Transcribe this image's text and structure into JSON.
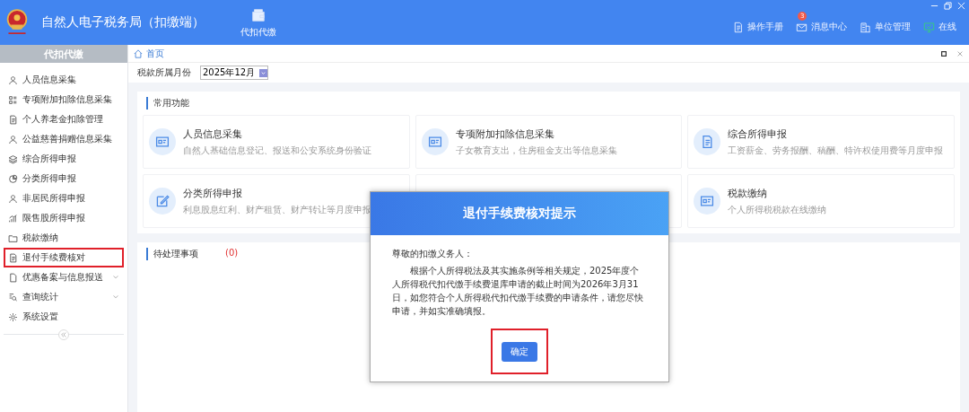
{
  "app": {
    "title": "自然人电子税务局（扣缴端）"
  },
  "top_nav": [
    {
      "label": "代扣代缴"
    }
  ],
  "toolbar": [
    {
      "label": "操作手册"
    },
    {
      "label": "消息中心",
      "badge": "3"
    },
    {
      "label": "单位管理"
    },
    {
      "label": "在线"
    }
  ],
  "sidebar": {
    "title": "代扣代缴",
    "items": [
      {
        "label": "人员信息采集",
        "expandable": false,
        "highlighted": false
      },
      {
        "label": "专项附加扣除信息采集",
        "expandable": false,
        "highlighted": false
      },
      {
        "label": "个人养老金扣除管理",
        "expandable": false,
        "highlighted": false
      },
      {
        "label": "公益慈善捐赠信息采集",
        "expandable": false,
        "highlighted": false
      },
      {
        "label": "综合所得申报",
        "expandable": false,
        "highlighted": false
      },
      {
        "label": "分类所得申报",
        "expandable": false,
        "highlighted": false
      },
      {
        "label": "非居民所得申报",
        "expandable": false,
        "highlighted": false
      },
      {
        "label": "限售股所得申报",
        "expandable": false,
        "highlighted": false
      },
      {
        "label": "税款缴纳",
        "expandable": false,
        "highlighted": false
      },
      {
        "label": "退付手续费核对",
        "expandable": false,
        "highlighted": true
      },
      {
        "label": "优惠备案与信息报送",
        "expandable": true,
        "highlighted": false
      },
      {
        "label": "查询统计",
        "expandable": true,
        "highlighted": false
      },
      {
        "label": "系统设置",
        "expandable": false,
        "highlighted": false
      }
    ]
  },
  "breadcrumb": "首页",
  "filter": {
    "label": "税款所属月份",
    "value": "2025年12月"
  },
  "common": {
    "title": "常用功能",
    "cards": [
      {
        "kind": "card",
        "title": "人员信息采集",
        "desc": "自然人基础信息登记、报送和公安系统身份验证"
      },
      {
        "kind": "card",
        "title": "专项附加扣除信息采集",
        "desc": "子女教育支出，住房租金支出等信息采集"
      },
      {
        "kind": "card",
        "title": "综合所得申报",
        "desc": "工资薪金、劳务报酬、稿酬、特许权使用费等月度申报"
      },
      {
        "kind": "card",
        "title": "分类所得申报",
        "desc": "利息股息红利、财产租赁、财产转让等月度申报"
      },
      {
        "kind": "covered"
      },
      {
        "kind": "card",
        "title": "税款缴纳",
        "desc": "个人所得税税款在线缴纳"
      }
    ]
  },
  "pending": {
    "title": "待处理事项",
    "count": "(0)"
  },
  "dialog": {
    "title": "退付手续费核对提示",
    "greeting": "尊敬的扣缴义务人：",
    "body": "根据个人所得税法及其实施条例等相关规定，2025年度个人所得税代扣代缴手续费退库申请的截止时间为2026年3月31日，如您符合个人所得税代扣代缴手续费的申请条件，请您尽快申请，并如实准确填报。",
    "button": "确定",
    "button_highlighted": true
  }
}
